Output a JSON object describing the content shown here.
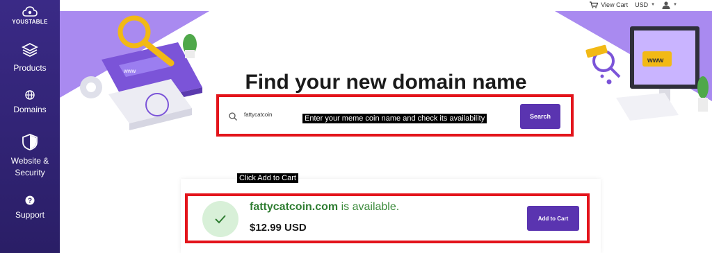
{
  "sidebar": {
    "logo_text": "YOUSTABLE",
    "items": [
      {
        "label": "Products",
        "icon": "layers-icon"
      },
      {
        "label": "Domains",
        "icon": "globe-icon"
      },
      {
        "label": "Website & Security",
        "icon": "shield-icon"
      },
      {
        "label": "Support",
        "icon": "help-icon"
      }
    ]
  },
  "topbar": {
    "view_cart": "View Cart",
    "currency": "USD"
  },
  "hero": {
    "title": "Find your new domain name"
  },
  "search": {
    "value": "fattycatcoin",
    "button_label": "Search",
    "tooltip": "Enter your meme coin name and check its availability"
  },
  "result": {
    "tooltip": "Click Add to Cart",
    "domain": "fattycatcoin.com",
    "status_text": " is available.",
    "price": "$12.99 USD",
    "cart_button_label": "Add to Cart"
  },
  "colors": {
    "sidebar": "#3a2a86",
    "accent": "#5a34b0",
    "highlight": "#e3141b",
    "available": "#2f7d32"
  }
}
